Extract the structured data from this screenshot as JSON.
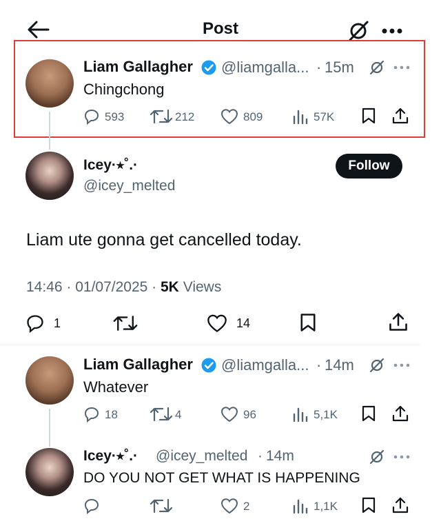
{
  "header": {
    "title": "Post"
  },
  "tweet1": {
    "name": "Liam Gallagher",
    "handle": "@liamgalla...",
    "time": "15m",
    "text": "Chingchong",
    "replies": "593",
    "retweets": "212",
    "likes": "809",
    "views": "57K"
  },
  "tweet2": {
    "name": "Icey·⭒˚.·",
    "handle": "@icey_melted",
    "follow_label": "Follow",
    "text": "Liam ute gonna get cancelled today.",
    "timestamp": "14:46 · 01/07/2025 ·",
    "views_count": "5K",
    "views_label": "Views",
    "replies": "1",
    "likes": "14"
  },
  "tweet3": {
    "name": "Liam Gallagher",
    "handle": "@liamgalla...",
    "time": "14m",
    "text": "Whatever",
    "replies": "18",
    "retweets": "4",
    "likes": "96",
    "views": "5,1K"
  },
  "tweet4": {
    "name": "Icey·⭒˚.·",
    "handle": "@icey_melted",
    "time": "14m",
    "text": "DO YOU NOT GET WHAT IS HAPPENING",
    "likes": "2",
    "views": "1,1K"
  },
  "colors": {
    "highlight": "#e03a3a",
    "verified": "#1d9bf0",
    "muted": "#536471"
  }
}
